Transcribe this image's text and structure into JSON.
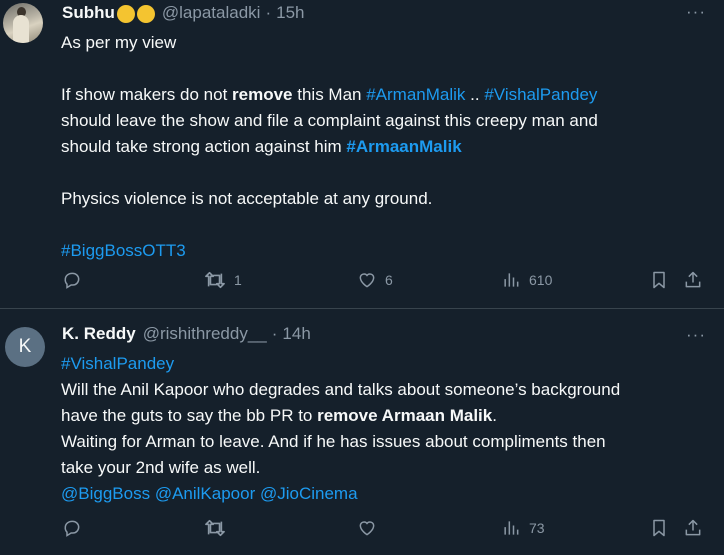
{
  "tweets": [
    {
      "name": "Subhu",
      "handle": "@lapataladki",
      "dot": "·",
      "time": "15h",
      "more": "···",
      "lines": {
        "l1": "As per my view",
        "l2a": "If show makers do not ",
        "l2b": "remove",
        "l2c": " this Man ",
        "l2d": "#ArmanMalik",
        "l2e": " .. ",
        "l2f": "#VishalPandey",
        "l3": "should leave the show and file a complaint against this creepy man and",
        "l4a": "should take strong action against him ",
        "l4b": "#ArmaanMalik",
        "l5": "Physics violence is not acceptable at any ground.",
        "l6": "#BiggBossOTT3"
      },
      "actions": {
        "reply": "",
        "retweet": "1",
        "like": "6",
        "views": "610"
      }
    },
    {
      "avatar_letter": "K",
      "name": "K. Reddy",
      "handle": "@rishithreddy__",
      "dot": "·",
      "time": "14h",
      "more": "···",
      "lines": {
        "l1": "#VishalPandey",
        "l2": "Will the Anil Kapoor who degrades and talks about someone’s background",
        "l3a": "have the guts to say the bb PR to ",
        "l3b": "remove Armaan Malik",
        "l3c": ".",
        "l4": "Waiting for Arman to leave. And if he has issues about compliments then",
        "l5": "take your 2nd wife as well.",
        "m1": "@BiggBoss",
        "m2": "@AnilKapoor",
        "m3": "@JioCinema"
      },
      "actions": {
        "reply": "",
        "retweet": "",
        "like": "",
        "views": "73"
      }
    }
  ],
  "colors": {
    "background": "#15202b",
    "text": "#f7f9f9",
    "muted": "#8b98a5",
    "link": "#1d9bf0",
    "divider": "#38444d"
  },
  "icons": [
    "reply-icon",
    "retweet-icon",
    "like-icon",
    "views-icon",
    "bookmark-icon",
    "share-icon",
    "more-icon"
  ]
}
